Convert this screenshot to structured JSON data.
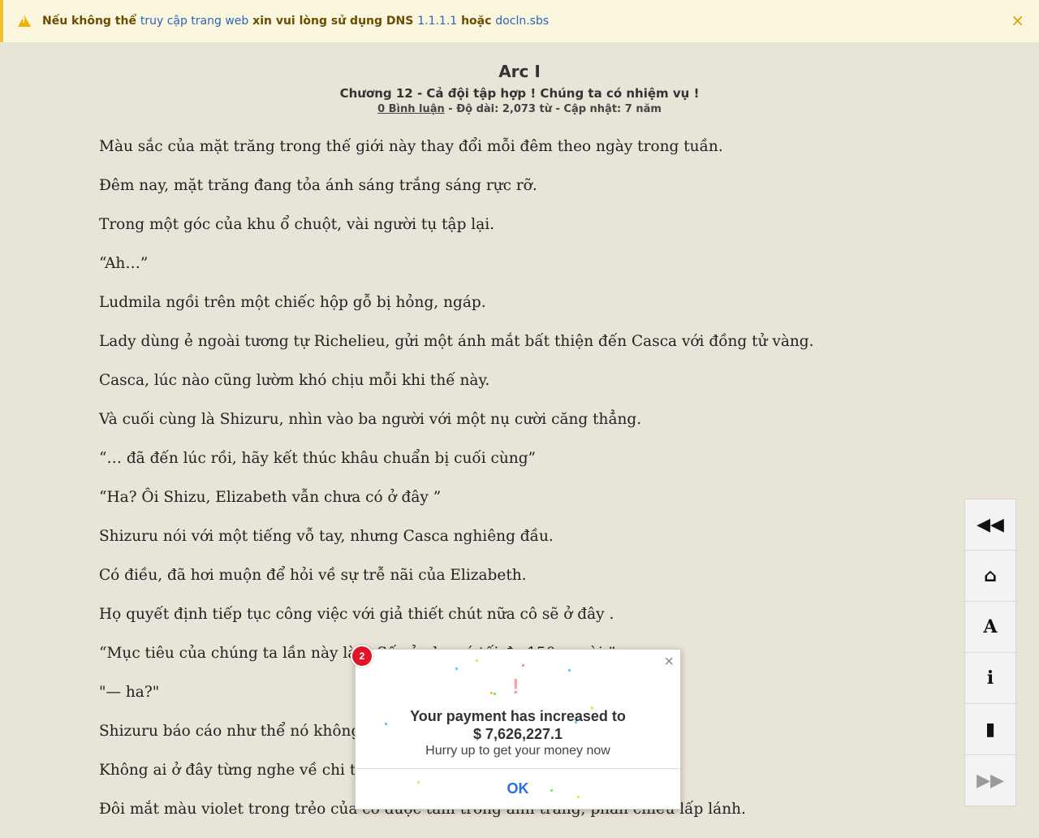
{
  "notice": {
    "part1": "Nếu không thể ",
    "link1": "truy cập trang web",
    "part2": " xin vui lòng sử dụng DNS ",
    "dns": "1.1.1.1",
    "part3": " hoặc ",
    "link2": "docln.sbs",
    "close": "×"
  },
  "header": {
    "arc": "Arc I",
    "chapter": "Chương 12 - Cả đội tập hợp ! Chúng ta có nhiệm vụ !",
    "comments": "0 Bình luận",
    "meta_rest": " - Độ dài: 2,073 từ - Cập nhật: 7 năm"
  },
  "paragraphs": [
    "Màu sắc của mặt trăng trong thế giới này thay đổi mỗi đêm theo ngày trong tuần.",
    "Đêm nay, mặt trăng đang tỏa ánh sáng trắng sáng rực rỡ.",
    "Trong một góc của khu ổ chuột, vài người tụ tập lại.",
    "“Ah…”",
    "Ludmila ngồi trên một chiếc hộp gỗ bị hỏng, ngáp.",
    "Lady dùng ẻ ngoài tương tự Richelieu, gửi một ánh mắt bất thiện đến Casca với đồng tử vàng.",
    "Casca, lúc nào cũng lườm khó chịu mỗi khi thế này.",
    "Và cuối cùng là Shizuru, nhìn vào ba người với một nụ cười căng thẳng.",
    "“… đã đến lúc rồi, hãy kết thúc khâu chuẩn bị cuối cùng”",
    "“Ha? Ôi Shizu, Elizabeth vẫn chưa có ở đây ”",
    "Shizuru nói với một tiếng vỗ tay, nhưng Casca nghiêng đầu.",
    "Có điều, đã hơi muộn để hỏi về sự trễ nãi của Elizabeth.",
    "Họ quyết định tiếp tục công việc với giả thiết chút nữa cô sẽ ở đây .",
    "“Mục tiêu của chúng ta lần này là                                                                t. Số của họ có tối đa 150 người ”",
    "\"— ha?\"",
    "Shizuru báo cáo như thể nó không",
    "Không ai ở đây từng nghe về chi ti                                                                         .",
    "Đôi mắt màu violet trong trẻo của cô được tắm trong ánh trăng, phản chiếu lấp lánh."
  ],
  "popup": {
    "badge": "2",
    "exclaim": "!",
    "line1": "Your payment has increased to",
    "line2": "$ 7,626,227.1",
    "line3": "Hurry up to get your money now",
    "ok": "OK",
    "close": "×"
  },
  "sidenav": {
    "prev": "◀◀",
    "home": "⌂",
    "font": "A",
    "info": "i",
    "bookmark": "▮",
    "next": "▶▶"
  },
  "colors": {
    "background": "#e9e4d8",
    "notice_bg": "#fbf7df",
    "notice_accent": "#f2c037",
    "link": "#2e63b8",
    "ok_blue": "#2d6fd8",
    "badge_red": "#e0142b"
  }
}
